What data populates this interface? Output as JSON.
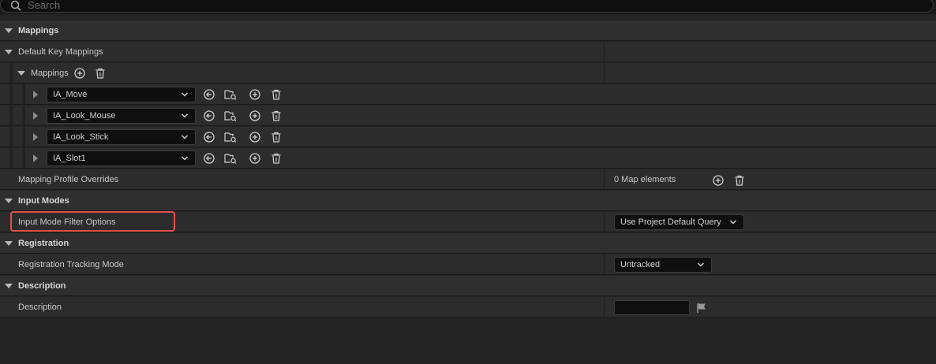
{
  "search": {
    "placeholder": "Search"
  },
  "categories": {
    "mappings": "Mappings",
    "input_modes": "Input Modes",
    "registration": "Registration",
    "description": "Description"
  },
  "properties": {
    "default_key_mappings": "Default Key Mappings",
    "mappings_array": "Mappings",
    "mapping_profile_overrides": "Mapping Profile Overrides",
    "mapping_profile_overrides_value": "0 Map elements",
    "input_mode_filter_options": "Input Mode Filter Options",
    "input_mode_filter_value": "Use Project Default Query",
    "registration_tracking_mode": "Registration Tracking Mode",
    "registration_tracking_value": "Untracked",
    "description_label": "Description",
    "description_value": ""
  },
  "mappings": [
    {
      "action": "IA_Move"
    },
    {
      "action": "IA_Look_Mouse"
    },
    {
      "action": "IA_Look_Stick"
    },
    {
      "action": "IA_Slot1"
    }
  ],
  "colors": {
    "background": "#242424",
    "highlight": "#e0504a",
    "input_bg": "#0f0f0f"
  }
}
